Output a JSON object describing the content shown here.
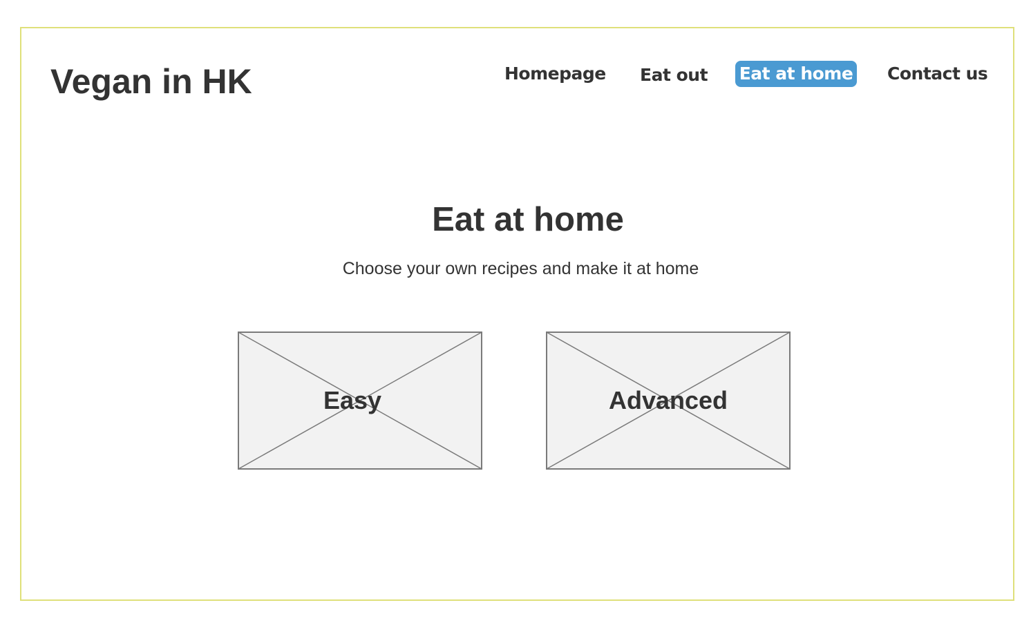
{
  "header": {
    "site_title": "Vegan in HK"
  },
  "nav": {
    "items": [
      {
        "label": "Homepage",
        "active": false
      },
      {
        "label": "Eat out",
        "active": false
      },
      {
        "label": "Eat at home",
        "active": true
      },
      {
        "label": "Contact us",
        "active": false
      }
    ]
  },
  "main": {
    "heading": "Eat at home",
    "subtitle": "Choose your own recipes and make it at home",
    "cards": [
      {
        "label": "Easy",
        "image": "image-placeholder"
      },
      {
        "label": "Advanced",
        "image": "image-placeholder"
      }
    ]
  },
  "colors": {
    "frame_border": "#dfe07a",
    "active_nav_bg": "#4a9ad2",
    "active_nav_text": "#ffffff",
    "text": "#333333",
    "placeholder_fill": "#f2f2f2",
    "placeholder_stroke": "#7a7a7a"
  }
}
